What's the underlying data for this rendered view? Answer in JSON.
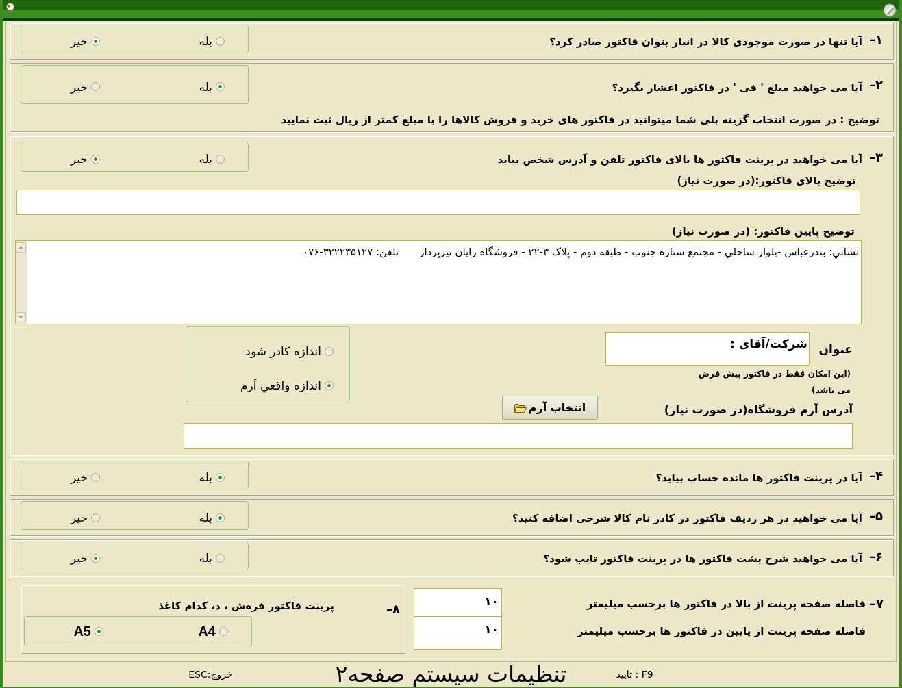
{
  "sections": [
    {
      "kind": "yes_no",
      "number": "۱–",
      "question": "آیا تنها در صورت موجودی کالا در انبار بتوان فاکتور صادر کرد؟",
      "options": [
        {
          "label": "بله",
          "selected": false
        },
        {
          "label": "خیر",
          "selected": true
        }
      ]
    },
    {
      "kind": "yes_no",
      "number": "۲–",
      "question": "آیا می خواهید مبلغ ' فی ' در فاکتور اعشار بگیرد؟",
      "options": [
        {
          "label": "بله",
          "selected": true
        },
        {
          "label": "خیر",
          "selected": false
        }
      ],
      "note": "توضیح : در صورت انتخاب گزینه بلی شما میتوانید در فاکتور های خرید و فروش کالاها را با مبلغ کمتر از ریال ثبت نمایید"
    },
    {
      "kind": "print_header",
      "number": "۳–",
      "question": "آیا می خواهید در پرینت فاکتور ها بالای فاکتور تلفن و آدرس شخص بیاید",
      "options": [
        {
          "label": "بله",
          "selected": false
        },
        {
          "label": "خیر",
          "selected": true
        }
      ],
      "header_label": "توضیح بالای فاکتور:(در صورت نیاز)",
      "footer_label": "توضیح پایین فاکتور: (در صورت نیاز)",
      "footer_note": {
        "address": "نشاني: بندرعباس -بلوار ساحلي - مجتمع ستاره جنوب - طبقه دوم - پلاک ۳-۲۲ - فروشگاه رايان تيزپرداز",
        "phone_label": "تلفن:",
        "phone": "۰۷۶-۳۲۲۲۳۵۱۲۷"
      },
      "logo_size_options": [
        {
          "label": "اندازه کادر شود",
          "selected": false
        },
        {
          "label": "اندازه واقعي آرم",
          "selected": true
        }
      ],
      "title_label": "عنوان",
      "title_value": "شرکت/آقای :",
      "title_hint": "(این امکان فقط در فاکتور پیش فرض می باشد)",
      "logo_path_label": "آدرس آرم فروشگاه(در صورت نیاز)",
      "logo_button": "انتخاب آرم"
    },
    {
      "kind": "yes_no",
      "number": "۴–",
      "question": "آیا در پرینت فاکتور ها مانده حساب بیاید؟",
      "options": [
        {
          "label": "بله",
          "selected": true
        },
        {
          "label": "خیر",
          "selected": false
        }
      ]
    },
    {
      "kind": "yes_no",
      "number": "۵–",
      "question": "آیا می خواهید در هر ردیف فاکتور در کادر نام کالا شرحی اضافه کنید؟",
      "options": [
        {
          "label": "بله",
          "selected": true
        },
        {
          "label": "خیر",
          "selected": false
        }
      ]
    },
    {
      "kind": "yes_no",
      "number": "۶–",
      "question": "آیا می خواهید شرح پشت فاکتور ها در پرینت فاکتور تایپ شود؟",
      "options": [
        {
          "label": "بله",
          "selected": false
        },
        {
          "label": "خیر",
          "selected": true
        }
      ]
    }
  ],
  "margins": {
    "number": "۷–",
    "rows": [
      {
        "label": "فاصله صفحه پرینت از بالا در فاکتور ها برحسب میلیمتر",
        "value": "۱۰"
      },
      {
        "label": "فاصله صفحه پرینت از پایین در فاکتور ها برحسب میلیمتر",
        "value": "۱۰"
      }
    ]
  },
  "paper": {
    "number": "۸–",
    "question": "پرینت فاکتور فرەش ، د، کدام کاغذ",
    "options": [
      {
        "label": "A4",
        "selected": false
      },
      {
        "label": "A5",
        "selected": true
      }
    ]
  },
  "footer": {
    "confirm": "F9 : تایید",
    "title": "تنظیمات سیستم صفحه۲",
    "exit": "خروج:ESC"
  }
}
